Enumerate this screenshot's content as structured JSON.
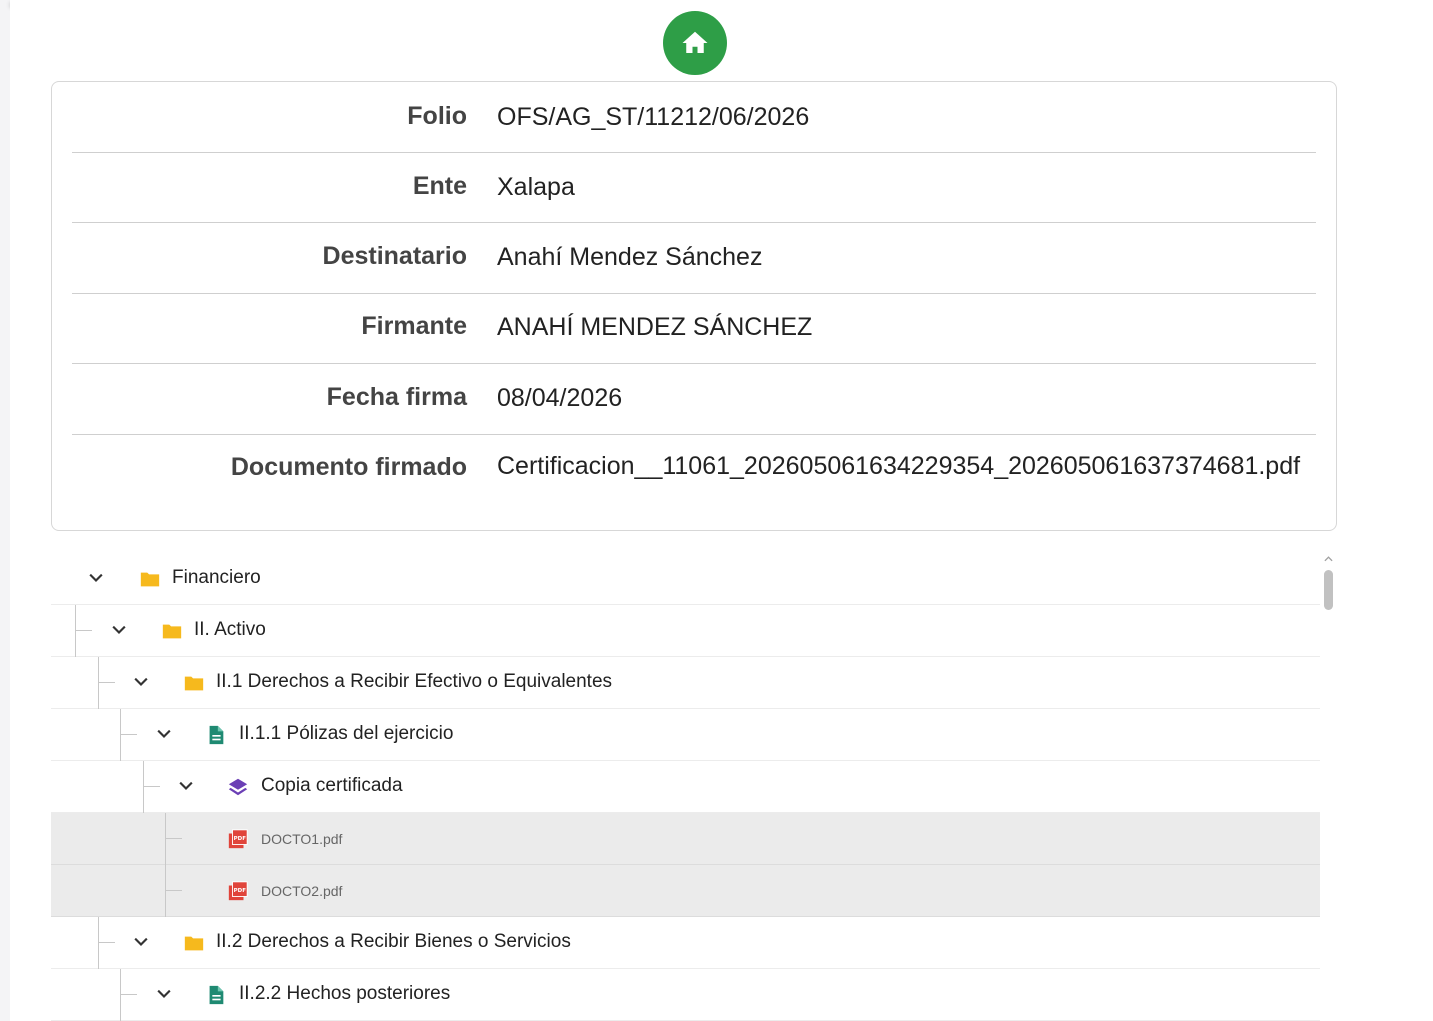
{
  "home": {
    "icon": "home-icon"
  },
  "details": {
    "rows": [
      {
        "label": "Folio",
        "value": "OFS/AG_ST/11212/06/2026"
      },
      {
        "label": "Ente",
        "value": "Xalapa"
      },
      {
        "label": "Destinatario",
        "value": "Anahí Mendez Sánchez"
      },
      {
        "label": "Firmante",
        "value": "ANAHÍ MENDEZ SÁNCHEZ"
      },
      {
        "label": "Fecha firma",
        "value": "08/04/2026"
      },
      {
        "label": "Documento firmado",
        "value": "Certificacion__11061_20260506163422935​4_20260506163737468​1.pdf"
      }
    ]
  },
  "tree": {
    "nodes": [
      {
        "label": "Financiero",
        "depth": 0,
        "icon": "folder-icon"
      },
      {
        "label": "II. Activo",
        "depth": 1,
        "icon": "folder-icon"
      },
      {
        "label": "II.1 Derechos a Recibir Efectivo o Equivalentes",
        "depth": 2,
        "icon": "folder-icon"
      },
      {
        "label": "II.1.1 Pólizas del ejercicio",
        "depth": 3,
        "icon": "document-icon"
      },
      {
        "label": "Copia certificada",
        "depth": 4,
        "icon": "layers-icon"
      },
      {
        "label": "DOCTO1.pdf",
        "depth": 5,
        "icon": "pdf-icon"
      },
      {
        "label": "DOCTO2.pdf",
        "depth": 5,
        "icon": "pdf-icon"
      },
      {
        "label": "II.2 Derechos a Recibir Bienes o Servicios",
        "depth": 2,
        "icon": "folder-icon"
      },
      {
        "label": "II.2.2 Hechos posteriores",
        "depth": 3,
        "icon": "document-icon"
      }
    ]
  },
  "colors": {
    "home_button": "#2e9e47",
    "folder": "#f6b91d",
    "document": "#1f8a72",
    "layers": "#6b3fb5",
    "pdf": "#e0443a"
  }
}
